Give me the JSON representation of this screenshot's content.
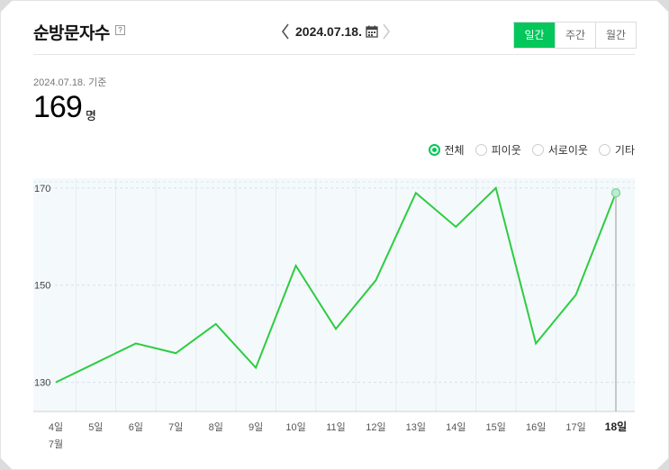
{
  "header": {
    "title": "순방문자수",
    "help_icon": "?",
    "date": "2024.07.18.",
    "period_tabs": [
      "일간",
      "주간",
      "월간"
    ],
    "active_period": "일간"
  },
  "summary": {
    "basis": "2024.07.18. 기준",
    "value": "169",
    "unit": "명"
  },
  "filters": {
    "options": [
      "전체",
      "피이웃",
      "서로이웃",
      "기타"
    ],
    "selected": "전체"
  },
  "colors": {
    "accent": "#03c75a",
    "plot_bg": "#f4f9fc",
    "line": "#2ecc40"
  },
  "chart_data": {
    "type": "line",
    "categories": [
      "4일",
      "5일",
      "6일",
      "7일",
      "8일",
      "9일",
      "10일",
      "11일",
      "12일",
      "13일",
      "14일",
      "15일",
      "16일",
      "17일",
      "18일"
    ],
    "month_label": "7월",
    "series": [
      {
        "values": [
          130,
          134,
          138,
          136,
          142,
          133,
          154,
          141,
          151,
          169,
          162,
          170,
          138,
          148,
          169
        ]
      }
    ],
    "yticks": [
      130,
      150,
      170
    ],
    "ylim": [
      124,
      172
    ],
    "highlight_last": true,
    "grid": true
  }
}
